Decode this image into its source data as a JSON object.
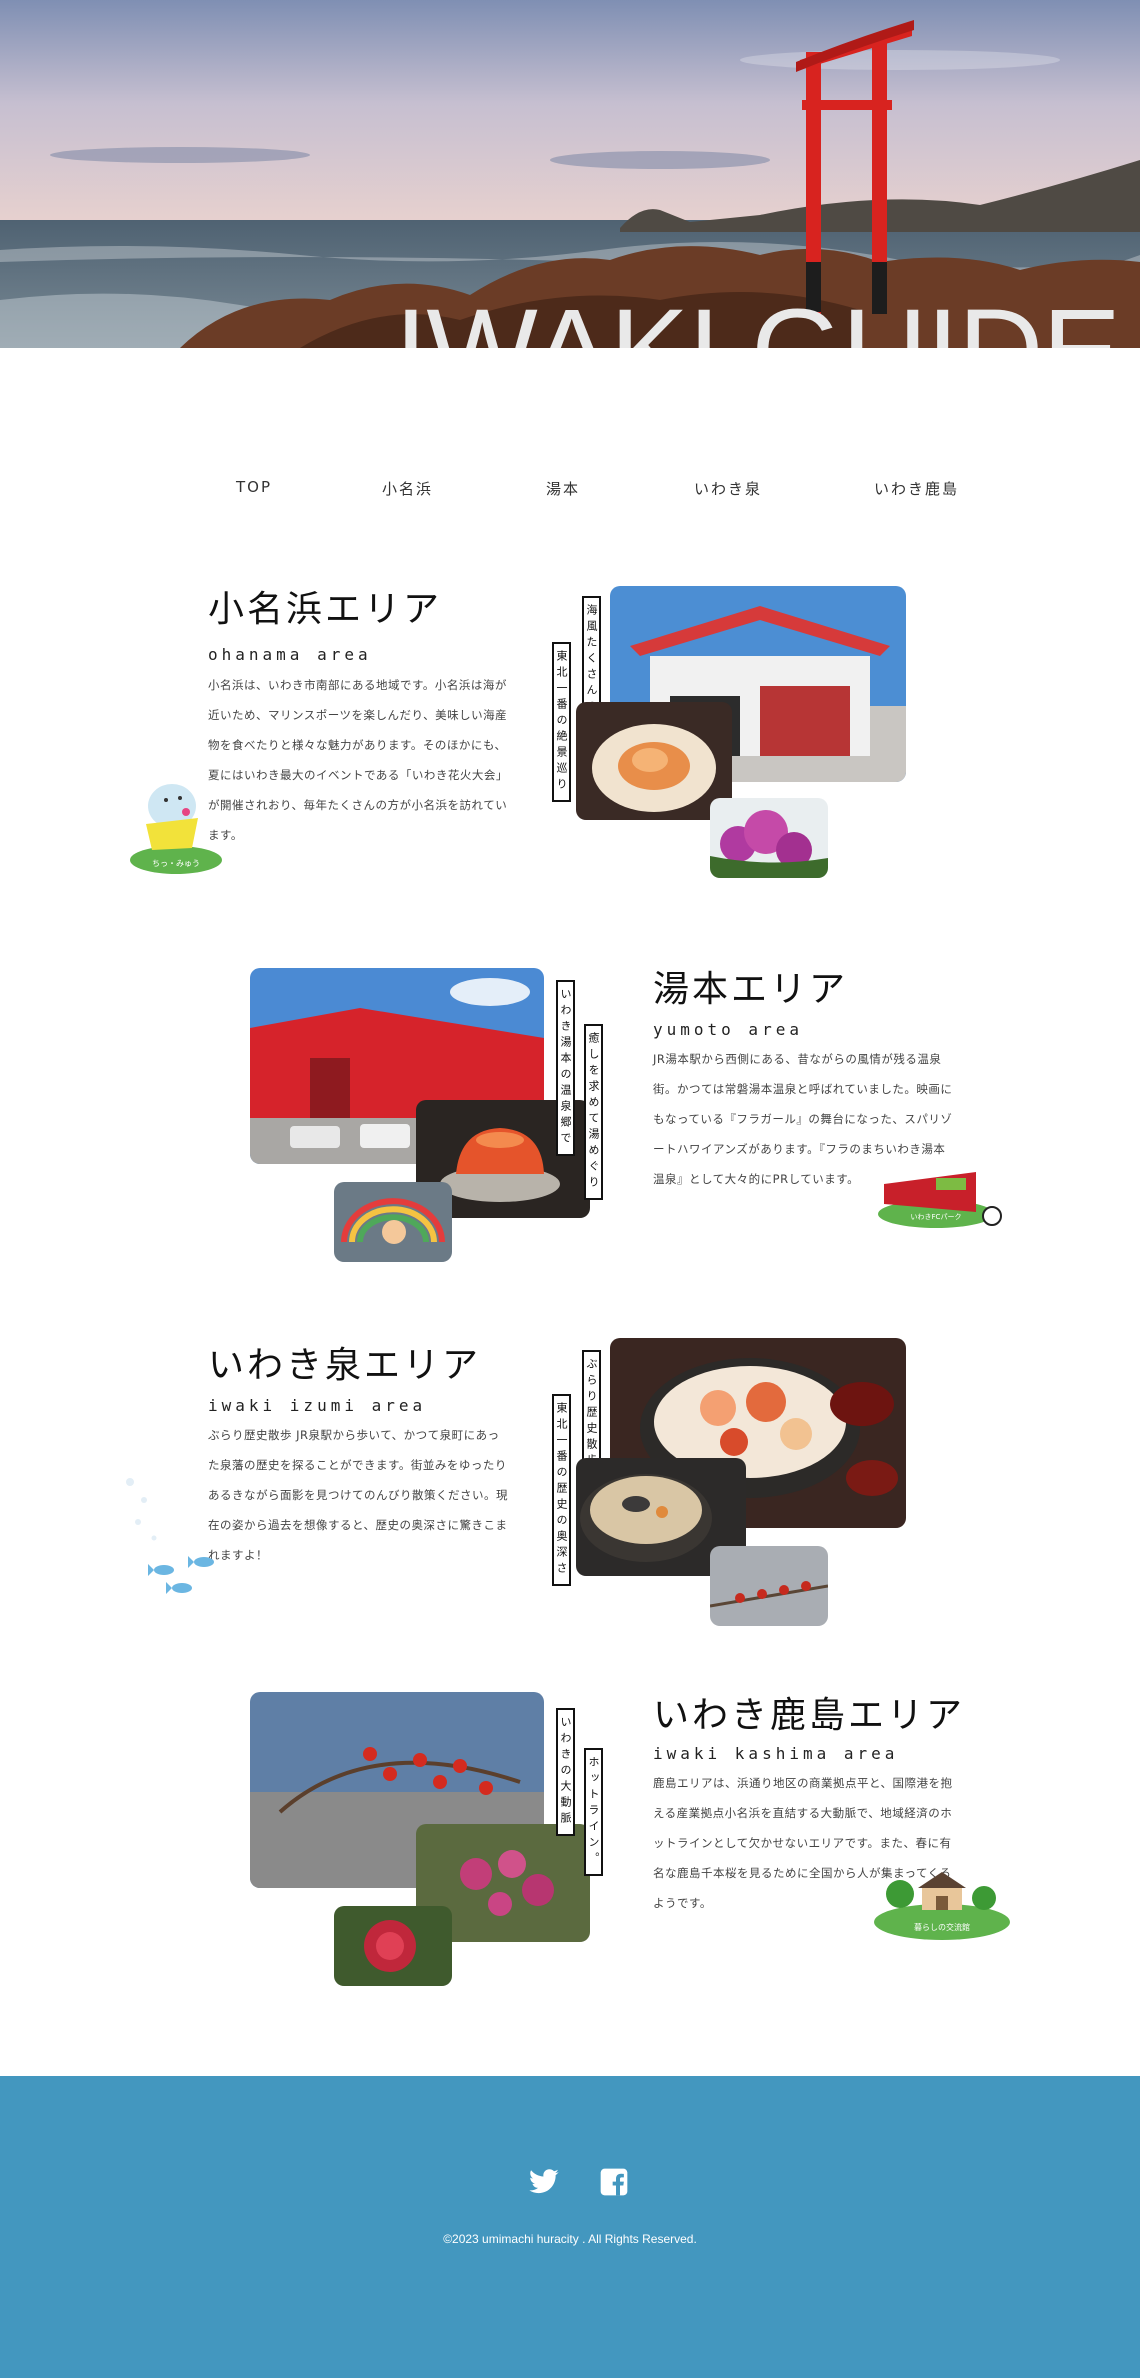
{
  "hero": {
    "title": "IWAKI GUIDE"
  },
  "nav": {
    "items": [
      {
        "label": "TOP"
      },
      {
        "label": "小名浜"
      },
      {
        "label": "湯本"
      },
      {
        "label": "いわき泉"
      },
      {
        "label": "いわき鹿島"
      }
    ]
  },
  "sections": [
    {
      "title": "小名浜エリア",
      "subtitle": "ohanama area",
      "body": "小名浜は、いわき市南部にある地域です。小名浜は海が近いため、マリンスポーツを楽しんだり、美味しい海産物を食べたりと様々な魅力があります。そのほかにも、夏にはいわき最大のイベントである「いわき花火大会」が開催されおり、毎年たくさんの方が小名浜を訪れています。",
      "labels": [
        "海風たくさんの",
        "東北一番の絶景巡り"
      ],
      "mascot_caption": "ちっ・みゅう"
    },
    {
      "title": "湯本エリア",
      "subtitle": "yumoto area",
      "body": "JR湯本駅から西側にある、昔ながらの風情が残る温泉街。かつては常磐湯本温泉と呼ばれていました。映画にもなっている『フラガール』の舞台になった、スパリゾートハワイアンズがあります。『フラのまちいわき湯本温泉』として大々的にPRしています。",
      "labels": [
        "いわき湯本の温泉郷で",
        "癒しを求めて湯めぐり"
      ],
      "mascot_caption": "いわきFCパーク"
    },
    {
      "title": "いわき泉エリア",
      "subtitle": "iwaki izumi area",
      "body": "ぶらり歴史散歩 JR泉駅から歩いて、かつて泉町にあった泉藩の歴史を探ることができます。街並みをゆったりあるきながら面影を見つけてのんびり散策ください。現在の姿から過去を想像すると、歴史の奥深さに驚きこまれますよ！",
      "labels": [
        "ぶらり歴史散歩",
        "東北一番の歴史の奥深さ"
      ]
    },
    {
      "title": "いわき鹿島エリア",
      "subtitle": "iwaki kashima area",
      "body": "鹿島エリアは、浜通り地区の商業拠点平と、国際港を抱える産業拠点小名浜を直結する大動脈で、地域経済のホットラインとして欠かせないエリアです。また、春に有名な鹿島千本桜を見るために全国から人が集まってくるようです。",
      "labels": [
        "いわきの大動脈",
        "ホットライン。"
      ],
      "mascot_caption": "暮らしの交流館"
    }
  ],
  "footer": {
    "twitter_icon": "twitter-icon",
    "facebook_icon": "facebook-icon",
    "copyright": "©2023 umimachi huracity . All Rights Reserved."
  },
  "colors": {
    "accent": "#4397bf",
    "torii": "#d8231f",
    "title_overlay": "#e9e9e9"
  }
}
